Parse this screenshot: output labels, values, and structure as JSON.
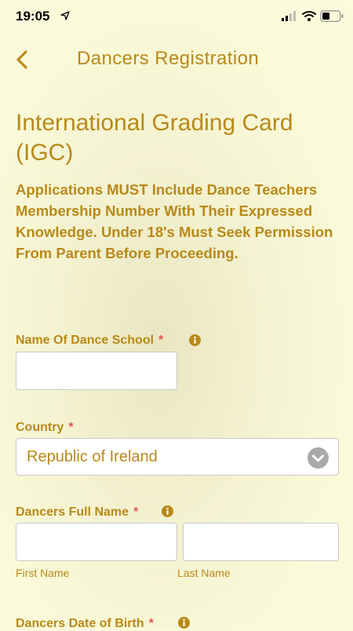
{
  "status_bar": {
    "time": "19:05"
  },
  "nav": {
    "title": "Dancers Registration"
  },
  "page": {
    "title": "International Grading Card (IGC)",
    "notice": "Applications MUST Include Dance Teachers Membership Number With Their Expressed Knowledge. Under 18's Must Seek Permission From Parent Before Proceeding."
  },
  "form": {
    "school": {
      "label": "Name Of Dance School",
      "required": "*",
      "value": ""
    },
    "country": {
      "label": "Country",
      "required": "*",
      "value": "Republic of Ireland"
    },
    "dancer_name": {
      "label": "Dancers Full Name",
      "required": "*",
      "first_label": "First Name",
      "last_label": "Last Name",
      "first_value": "",
      "last_value": ""
    },
    "dob": {
      "label": "Dancers Date of Birth",
      "required": "*"
    }
  },
  "colors": {
    "accent": "#b8891b",
    "required": "#e0574f",
    "background": "#fafad9"
  }
}
